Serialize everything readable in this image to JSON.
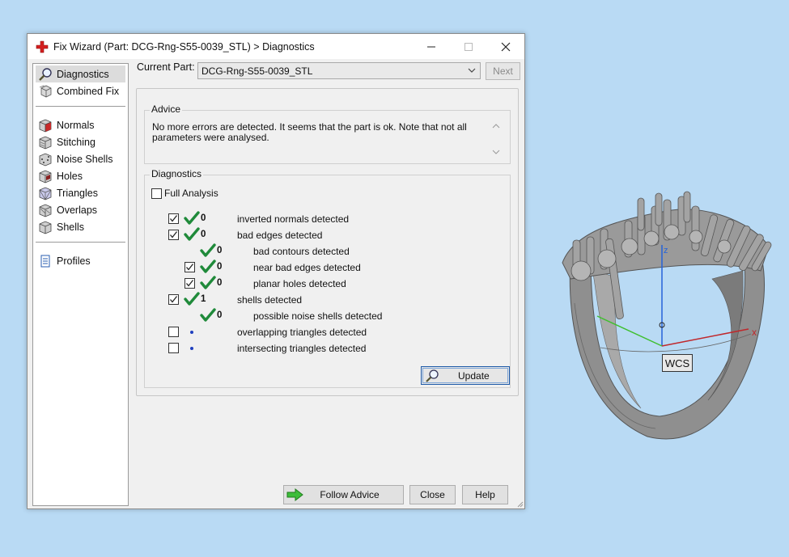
{
  "window": {
    "title": "Fix Wizard (Part: DCG-Rng-S55-0039_STL) > Diagnostics"
  },
  "nav": {
    "items_top": [
      {
        "label": "Diagnostics",
        "icon": "magnifier-icon",
        "active": true
      },
      {
        "label": "Combined Fix",
        "icon": "combined-fix-icon",
        "active": false
      }
    ],
    "items_mid": [
      {
        "label": "Normals",
        "icon": "normals-cube-icon"
      },
      {
        "label": "Stitching",
        "icon": "stitching-cube-icon"
      },
      {
        "label": "Noise Shells",
        "icon": "noise-shells-cube-icon"
      },
      {
        "label": "Holes",
        "icon": "holes-cube-icon"
      },
      {
        "label": "Triangles",
        "icon": "triangles-cube-icon"
      },
      {
        "label": "Overlaps",
        "icon": "overlaps-cube-icon"
      },
      {
        "label": "Shells",
        "icon": "shells-cube-icon"
      }
    ],
    "items_bottom": [
      {
        "label": "Profiles",
        "icon": "document-icon"
      }
    ]
  },
  "part": {
    "label": "Current Part:",
    "value": "DCG-Rng-S55-0039_STL",
    "next_label": "Next"
  },
  "advice": {
    "legend": "Advice",
    "text": "No more errors are detected. It seems that the part is ok. Note that not all parameters were analysed."
  },
  "diagnostics": {
    "legend": "Diagnostics",
    "full_analysis_label": "Full Analysis",
    "full_analysis_checked": false,
    "rows": [
      {
        "checkbox": true,
        "checked": true,
        "status": "check",
        "count": "0",
        "label": "inverted normals detected",
        "indent": 0
      },
      {
        "checkbox": true,
        "checked": true,
        "status": "check",
        "count": "0",
        "label": "bad edges detected",
        "indent": 0
      },
      {
        "checkbox": false,
        "checked": false,
        "status": "check",
        "count": "0",
        "label": "bad contours detected",
        "indent": 1
      },
      {
        "checkbox": true,
        "checked": true,
        "status": "check",
        "count": "0",
        "label": "near bad edges detected",
        "indent": 1
      },
      {
        "checkbox": true,
        "checked": true,
        "status": "check",
        "count": "0",
        "label": "planar holes detected",
        "indent": 1
      },
      {
        "checkbox": true,
        "checked": true,
        "status": "check",
        "count": "1",
        "label": "shells detected",
        "indent": 0
      },
      {
        "checkbox": false,
        "checked": false,
        "status": "check",
        "count": "0",
        "label": "possible noise shells detected",
        "indent": 1
      },
      {
        "checkbox": true,
        "checked": false,
        "status": "dot",
        "count": "",
        "label": "overlapping triangles detected",
        "indent": 0
      },
      {
        "checkbox": true,
        "checked": false,
        "status": "dot",
        "count": "",
        "label": "intersecting triangles detected",
        "indent": 0
      }
    ],
    "update_label": "Update"
  },
  "buttons": {
    "follow_advice": "Follow Advice",
    "close": "Close",
    "help": "Help"
  },
  "viewport": {
    "wcs_label": "WCS",
    "axis_labels": {
      "x": "x",
      "z": "z"
    },
    "colors": {
      "x_axis": "#c0282c",
      "y_axis": "#3fbf2f",
      "z_axis": "#2563d9",
      "model": "#8c8c8c"
    }
  },
  "colors": {
    "background": "#b9daf4",
    "check_green": "#1f8a3a",
    "accent_blue": "#1e5aa8"
  }
}
